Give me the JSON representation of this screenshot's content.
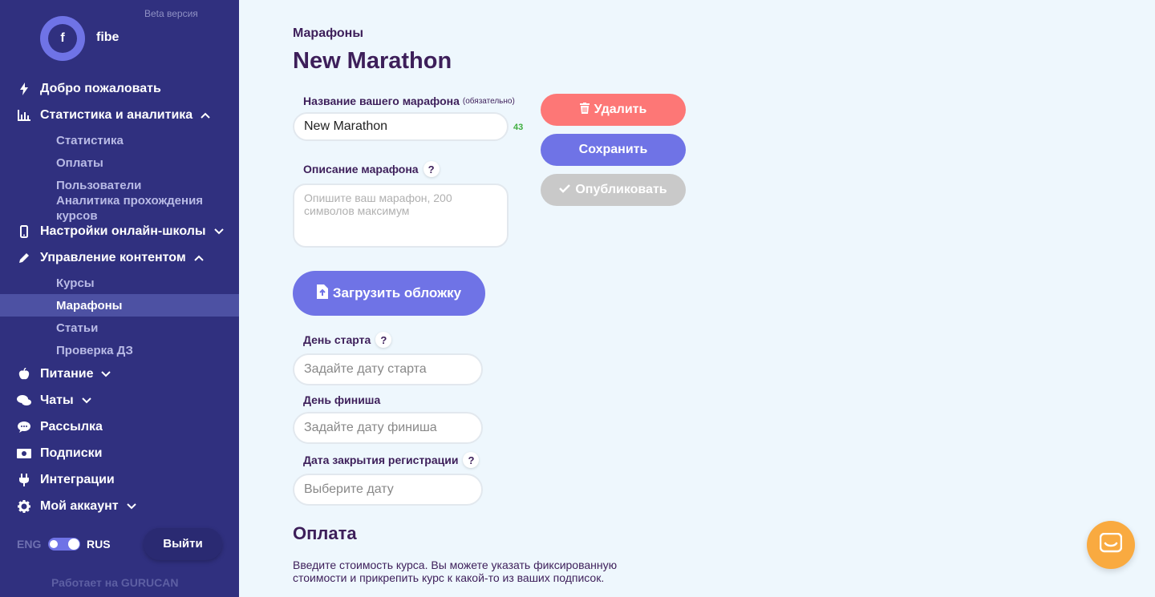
{
  "sidebar": {
    "beta": "Beta версия",
    "avatar_letter": "f",
    "username": "fibe",
    "items": [
      {
        "label": "Добро пожаловать",
        "icon": "bolt-icon"
      },
      {
        "label": "Статистика и аналитика",
        "icon": "chart-icon",
        "expanded": true
      },
      {
        "label": "Настройки онлайн-школы",
        "icon": "mobile-icon",
        "expanded": false
      },
      {
        "label": "Управление контентом",
        "icon": "pencil-icon",
        "expanded": true
      },
      {
        "label": "Питание",
        "icon": "apple-icon",
        "expanded": false
      },
      {
        "label": "Чаты",
        "icon": "chat-icon",
        "expanded": false
      },
      {
        "label": "Рассылка",
        "icon": "comment-icon"
      },
      {
        "label": "Подписки",
        "icon": "money-icon"
      },
      {
        "label": "Интеграции",
        "icon": "plug-icon"
      },
      {
        "label": "Мой аккаунт",
        "icon": "gear-icon",
        "expanded": false
      }
    ],
    "stats_sub": [
      "Статистика",
      "Оплаты",
      "Пользователи",
      "Аналитика прохождения курсов"
    ],
    "content_sub": [
      "Курсы",
      "Марафоны",
      "Статьи",
      "Проверка ДЗ"
    ],
    "active_sub": "Марафоны",
    "lang_eng": "ENG",
    "lang_rus": "RUS",
    "logout": "Выйти",
    "powered": "Работает на GURUCAN"
  },
  "main": {
    "breadcrumb": "Марафоны",
    "title": "New Marathon",
    "name_label": "Название вашего марафона",
    "name_required": "(обязательно)",
    "name_value": "New Marathon",
    "name_counter": "43",
    "desc_label": "Описание марафона",
    "desc_placeholder": "Опишите ваш марафон, 200 символов максимум",
    "upload_cover": "Загрузить обложку",
    "start_label": "День старта",
    "start_placeholder": "Задайте дату старта",
    "finish_label": "День финиша",
    "finish_placeholder": "Задайте дату финиша",
    "close_label": "Дата закрытия регистрации",
    "close_placeholder": "Выберите дату",
    "payment_title": "Оплата",
    "payment_desc": "Введите стоимость курса. Вы можете указать фиксированную стоимости и прикрепить курс к какой-то из ваших подписок."
  },
  "actions": {
    "delete": "Удалить",
    "save": "Сохранить",
    "publish": "Опубликовать"
  },
  "colors": {
    "sidebar_bg": "#30307f",
    "accent": "#6f73e6",
    "delete": "#fd7776",
    "disabled": "#c9c9c9",
    "chat": "#f9aa40"
  }
}
